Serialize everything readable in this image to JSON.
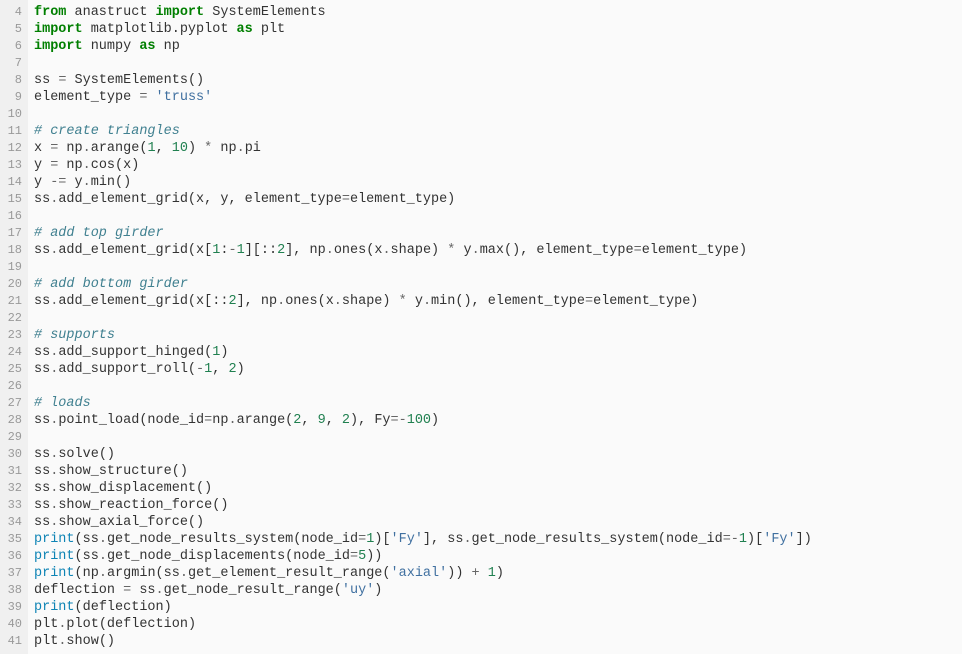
{
  "first_line_number": 4,
  "lines": [
    [
      [
        "kw",
        "from"
      ],
      [
        "pn",
        " anastruct "
      ],
      [
        "kw",
        "import"
      ],
      [
        "pn",
        " SystemElements"
      ]
    ],
    [
      [
        "kw",
        "import"
      ],
      [
        "pn",
        " matplotlib.pyplot "
      ],
      [
        "kw",
        "as"
      ],
      [
        "pn",
        " plt"
      ]
    ],
    [
      [
        "kw",
        "import"
      ],
      [
        "pn",
        " numpy "
      ],
      [
        "kw",
        "as"
      ],
      [
        "pn",
        " np"
      ]
    ],
    [],
    [
      [
        "pn",
        "ss "
      ],
      [
        "op",
        "="
      ],
      [
        "pn",
        " SystemElements()"
      ]
    ],
    [
      [
        "pn",
        "element_type "
      ],
      [
        "op",
        "="
      ],
      [
        "pn",
        " "
      ],
      [
        "str",
        "'truss'"
      ]
    ],
    [],
    [
      [
        "cm",
        "# create triangles"
      ]
    ],
    [
      [
        "pn",
        "x "
      ],
      [
        "op",
        "="
      ],
      [
        "pn",
        " np"
      ],
      [
        "op",
        "."
      ],
      [
        "pn",
        "arange("
      ],
      [
        "num",
        "1"
      ],
      [
        "pn",
        ", "
      ],
      [
        "num",
        "10"
      ],
      [
        "pn",
        ") "
      ],
      [
        "op",
        "*"
      ],
      [
        "pn",
        " np"
      ],
      [
        "op",
        "."
      ],
      [
        "pn",
        "pi"
      ]
    ],
    [
      [
        "pn",
        "y "
      ],
      [
        "op",
        "="
      ],
      [
        "pn",
        " np"
      ],
      [
        "op",
        "."
      ],
      [
        "pn",
        "cos(x)"
      ]
    ],
    [
      [
        "pn",
        "y "
      ],
      [
        "op",
        "-="
      ],
      [
        "pn",
        " y"
      ],
      [
        "op",
        "."
      ],
      [
        "pn",
        "min()"
      ]
    ],
    [
      [
        "pn",
        "ss"
      ],
      [
        "op",
        "."
      ],
      [
        "pn",
        "add_element_grid(x, y, element_type"
      ],
      [
        "op",
        "="
      ],
      [
        "pn",
        "element_type)"
      ]
    ],
    [],
    [
      [
        "cm",
        "# add top girder"
      ]
    ],
    [
      [
        "pn",
        "ss"
      ],
      [
        "op",
        "."
      ],
      [
        "pn",
        "add_element_grid(x["
      ],
      [
        "num",
        "1"
      ],
      [
        "pn",
        ":"
      ],
      [
        "op",
        "-"
      ],
      [
        "num",
        "1"
      ],
      [
        "pn",
        "][::"
      ],
      [
        "num",
        "2"
      ],
      [
        "pn",
        "], np"
      ],
      [
        "op",
        "."
      ],
      [
        "pn",
        "ones(x"
      ],
      [
        "op",
        "."
      ],
      [
        "pn",
        "shape) "
      ],
      [
        "op",
        "*"
      ],
      [
        "pn",
        " y"
      ],
      [
        "op",
        "."
      ],
      [
        "pn",
        "max(), element_type"
      ],
      [
        "op",
        "="
      ],
      [
        "pn",
        "element_type)"
      ]
    ],
    [],
    [
      [
        "cm",
        "# add bottom girder"
      ]
    ],
    [
      [
        "pn",
        "ss"
      ],
      [
        "op",
        "."
      ],
      [
        "pn",
        "add_element_grid(x[::"
      ],
      [
        "num",
        "2"
      ],
      [
        "pn",
        "], np"
      ],
      [
        "op",
        "."
      ],
      [
        "pn",
        "ones(x"
      ],
      [
        "op",
        "."
      ],
      [
        "pn",
        "shape) "
      ],
      [
        "op",
        "*"
      ],
      [
        "pn",
        " y"
      ],
      [
        "op",
        "."
      ],
      [
        "pn",
        "min(), element_type"
      ],
      [
        "op",
        "="
      ],
      [
        "pn",
        "element_type)"
      ]
    ],
    [],
    [
      [
        "cm",
        "# supports"
      ]
    ],
    [
      [
        "pn",
        "ss"
      ],
      [
        "op",
        "."
      ],
      [
        "pn",
        "add_support_hinged("
      ],
      [
        "num",
        "1"
      ],
      [
        "pn",
        ")"
      ]
    ],
    [
      [
        "pn",
        "ss"
      ],
      [
        "op",
        "."
      ],
      [
        "pn",
        "add_support_roll("
      ],
      [
        "op",
        "-"
      ],
      [
        "num",
        "1"
      ],
      [
        "pn",
        ", "
      ],
      [
        "num",
        "2"
      ],
      [
        "pn",
        ")"
      ]
    ],
    [],
    [
      [
        "cm",
        "# loads"
      ]
    ],
    [
      [
        "pn",
        "ss"
      ],
      [
        "op",
        "."
      ],
      [
        "pn",
        "point_load(node_id"
      ],
      [
        "op",
        "="
      ],
      [
        "pn",
        "np"
      ],
      [
        "op",
        "."
      ],
      [
        "pn",
        "arange("
      ],
      [
        "num",
        "2"
      ],
      [
        "pn",
        ", "
      ],
      [
        "num",
        "9"
      ],
      [
        "pn",
        ", "
      ],
      [
        "num",
        "2"
      ],
      [
        "pn",
        "), Fy"
      ],
      [
        "op",
        "=-"
      ],
      [
        "num",
        "100"
      ],
      [
        "pn",
        ")"
      ]
    ],
    [],
    [
      [
        "pn",
        "ss"
      ],
      [
        "op",
        "."
      ],
      [
        "pn",
        "solve()"
      ]
    ],
    [
      [
        "pn",
        "ss"
      ],
      [
        "op",
        "."
      ],
      [
        "pn",
        "show_structure()"
      ]
    ],
    [
      [
        "pn",
        "ss"
      ],
      [
        "op",
        "."
      ],
      [
        "pn",
        "show_displacement()"
      ]
    ],
    [
      [
        "pn",
        "ss"
      ],
      [
        "op",
        "."
      ],
      [
        "pn",
        "show_reaction_force()"
      ]
    ],
    [
      [
        "pn",
        "ss"
      ],
      [
        "op",
        "."
      ],
      [
        "pn",
        "show_axial_force()"
      ]
    ],
    [
      [
        "nm",
        "print"
      ],
      [
        "pn",
        "(ss"
      ],
      [
        "op",
        "."
      ],
      [
        "pn",
        "get_node_results_system(node_id"
      ],
      [
        "op",
        "="
      ],
      [
        "num",
        "1"
      ],
      [
        "pn",
        ")["
      ],
      [
        "str",
        "'Fy'"
      ],
      [
        "pn",
        "], ss"
      ],
      [
        "op",
        "."
      ],
      [
        "pn",
        "get_node_results_system(node_id"
      ],
      [
        "op",
        "=-"
      ],
      [
        "num",
        "1"
      ],
      [
        "pn",
        ")["
      ],
      [
        "str",
        "'Fy'"
      ],
      [
        "pn",
        "])"
      ]
    ],
    [
      [
        "nm",
        "print"
      ],
      [
        "pn",
        "(ss"
      ],
      [
        "op",
        "."
      ],
      [
        "pn",
        "get_node_displacements(node_id"
      ],
      [
        "op",
        "="
      ],
      [
        "num",
        "5"
      ],
      [
        "pn",
        "))"
      ]
    ],
    [
      [
        "nm",
        "print"
      ],
      [
        "pn",
        "(np"
      ],
      [
        "op",
        "."
      ],
      [
        "pn",
        "argmin(ss"
      ],
      [
        "op",
        "."
      ],
      [
        "pn",
        "get_element_result_range("
      ],
      [
        "str",
        "'axial'"
      ],
      [
        "pn",
        ")) "
      ],
      [
        "op",
        "+"
      ],
      [
        "pn",
        " "
      ],
      [
        "num",
        "1"
      ],
      [
        "pn",
        ")"
      ]
    ],
    [
      [
        "pn",
        "deflection "
      ],
      [
        "op",
        "="
      ],
      [
        "pn",
        " ss"
      ],
      [
        "op",
        "."
      ],
      [
        "pn",
        "get_node_result_range("
      ],
      [
        "str",
        "'uy'"
      ],
      [
        "pn",
        ")"
      ]
    ],
    [
      [
        "nm",
        "print"
      ],
      [
        "pn",
        "(deflection)"
      ]
    ],
    [
      [
        "pn",
        "plt"
      ],
      [
        "op",
        "."
      ],
      [
        "pn",
        "plot(deflection)"
      ]
    ],
    [
      [
        "pn",
        "plt"
      ],
      [
        "op",
        "."
      ],
      [
        "pn",
        "show()"
      ]
    ]
  ]
}
